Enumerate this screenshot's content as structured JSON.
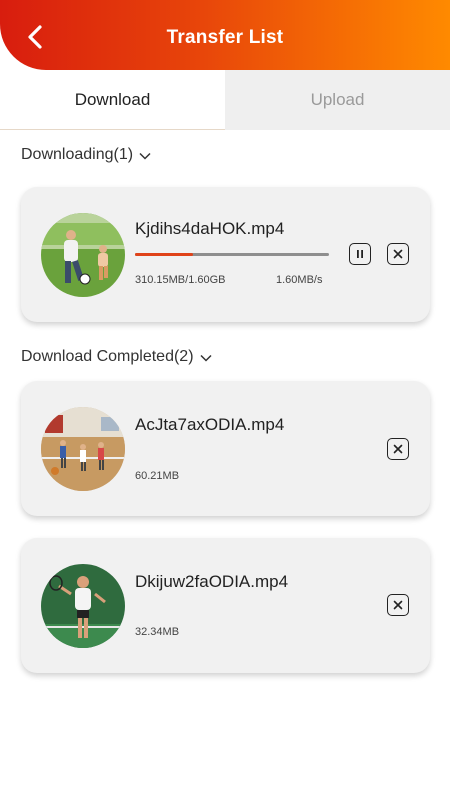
{
  "header": {
    "title": "Transfer List",
    "back_icon": "chevron-left-icon",
    "gradient_colors": [
      "#d81d0e",
      "#ff8a00"
    ]
  },
  "tabs": [
    {
      "label": "Download",
      "active": true
    },
    {
      "label": "Upload",
      "active": false
    }
  ],
  "downloading": {
    "section_title": "Downloading(1)",
    "items": [
      {
        "filename": "Kjdihs4daHOK.mp4",
        "progress_text": "310.15MB/1.60GB",
        "speed": "1.60MB/s",
        "progress_fraction": 0.3,
        "progress_color": "#e0431a",
        "thumbnail": "family-playing-soccer-photo"
      }
    ]
  },
  "completed": {
    "section_title": "Download Completed(2)",
    "items": [
      {
        "filename": "AcJta7axODIA.mp4",
        "size": "60.21MB",
        "thumbnail": "gym-basketball-photo"
      },
      {
        "filename": "Dkijuw2faODIA.mp4",
        "size": "32.34MB",
        "thumbnail": "tennis-player-photo"
      }
    ]
  }
}
